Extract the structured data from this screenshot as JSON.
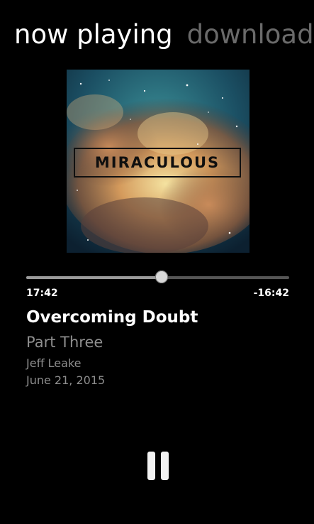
{
  "pivot": {
    "tabs": [
      {
        "label": "now playing",
        "active": true
      },
      {
        "label": "downloads",
        "active": false
      }
    ]
  },
  "album_art": {
    "title": "MIRACULOUS"
  },
  "player": {
    "elapsed": "17:42",
    "remaining": "-16:42",
    "progress_fraction": 0.515
  },
  "track": {
    "title": "Overcoming Doubt",
    "subtitle": "Part Three",
    "author": "Jeff Leake",
    "date": "June 21, 2015"
  },
  "controls": {
    "pause_icon": "pause-icon"
  }
}
